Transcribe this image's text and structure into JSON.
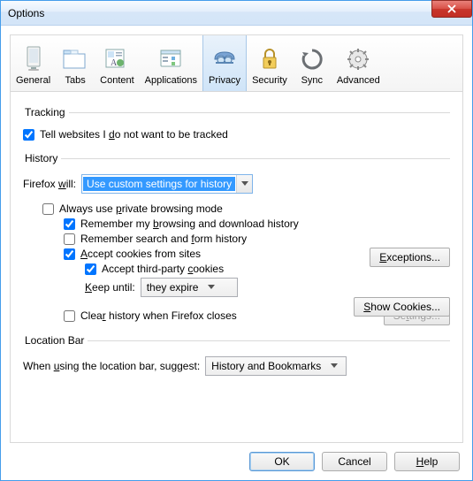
{
  "window": {
    "title": "Options"
  },
  "tabs": {
    "general": "General",
    "tabs": "Tabs",
    "content": "Content",
    "applications": "Applications",
    "privacy": "Privacy",
    "security": "Security",
    "sync": "Sync",
    "advanced": "Advanced"
  },
  "tracking": {
    "legend": "Tracking",
    "dnt": "Tell websites I do not want to be tracked",
    "dnt_checked": true
  },
  "history": {
    "legend": "History",
    "firefox_will": "Firefox will:",
    "mode": "Use custom settings for history",
    "always_private": "Always use private browsing mode",
    "always_private_checked": false,
    "remember_browsing": "Remember my browsing and download history",
    "remember_browsing_checked": true,
    "remember_search": "Remember search and form history",
    "remember_search_checked": false,
    "accept_cookies": "Accept cookies from sites",
    "accept_cookies_checked": true,
    "accept_third": "Accept third-party cookies",
    "accept_third_checked": true,
    "keep_until_label": "Keep until:",
    "keep_until_value": "they expire",
    "clear_on_close": "Clear history when Firefox closes",
    "clear_on_close_checked": false,
    "exceptions_btn": "Exceptions...",
    "show_cookies_btn": "Show Cookies...",
    "settings_btn": "Settings..."
  },
  "location_bar": {
    "legend": "Location Bar",
    "suggest_label": "When using the location bar, suggest:",
    "suggest_value": "History and Bookmarks"
  },
  "buttons": {
    "ok": "OK",
    "cancel": "Cancel",
    "help": "Help"
  }
}
